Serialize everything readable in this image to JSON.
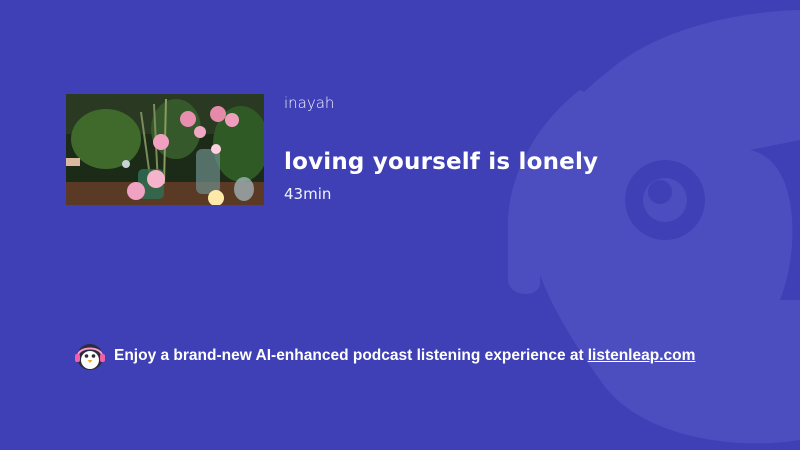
{
  "episode": {
    "author": "inayah",
    "title": "loving yourself is lonely",
    "duration": "43min",
    "thumbnail_icon": "flower-arrangement-thumbnail"
  },
  "promo": {
    "text": "Enjoy a brand-new AI-enhanced podcast listening experience at",
    "link_text": "listenleap.com",
    "mascot_icon": "penguin-headphones-icon"
  },
  "colors": {
    "background": "#3f40b5",
    "logo_watermark": "#5152c2",
    "text": "#ffffff"
  },
  "background_icon": "listenleap-logo-watermark"
}
